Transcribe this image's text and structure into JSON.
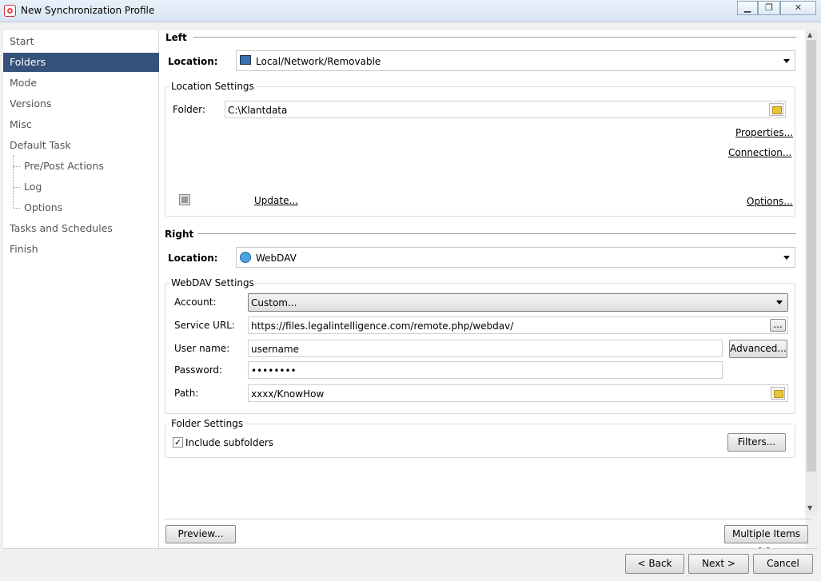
{
  "window": {
    "title": "New Synchronization Profile"
  },
  "sidebar": {
    "items": [
      {
        "label": "Start"
      },
      {
        "label": "Folders"
      },
      {
        "label": "Mode"
      },
      {
        "label": "Versions"
      },
      {
        "label": "Misc"
      },
      {
        "label": "Default Task"
      },
      {
        "label": "Pre/Post Actions"
      },
      {
        "label": "Log"
      },
      {
        "label": "Options"
      },
      {
        "label": "Tasks and Schedules"
      },
      {
        "label": "Finish"
      }
    ],
    "active": "Folders"
  },
  "left": {
    "heading": "Left",
    "location_label": "Location:",
    "location_value": "Local/Network/Removable",
    "settings_title": "Location Settings",
    "folder_label": "Folder:",
    "folder_value": "C:\\Klantdata",
    "properties_link": "Properties...",
    "connection_link": "Connection...",
    "update_link": "Update...",
    "options_link": "Options..."
  },
  "right": {
    "heading": "Right",
    "location_label": "Location:",
    "location_value": "WebDAV",
    "settings_title": "WebDAV Settings",
    "account_label": "Account:",
    "account_value": "Custom...",
    "service_url_label": "Service URL:",
    "service_url_value": "https://files.legalintelligence.com/remote.php/webdav/",
    "browse_button": "...",
    "username_label": "User name:",
    "username_value": "username",
    "advanced_button": "Advanced...",
    "password_label": "Password:",
    "password_value": "••••••••",
    "path_label": "Path:",
    "path_value": "xxxx/KnowHow"
  },
  "folder_settings": {
    "title": "Folder Settings",
    "include_subfolders_label": "Include subfolders",
    "include_subfolders_checked": true,
    "filters_button": "Filters..."
  },
  "actions": {
    "preview": "Preview...",
    "multiple_items": "Multiple Items >>",
    "back": "< Back",
    "next": "Next >",
    "cancel": "Cancel"
  }
}
